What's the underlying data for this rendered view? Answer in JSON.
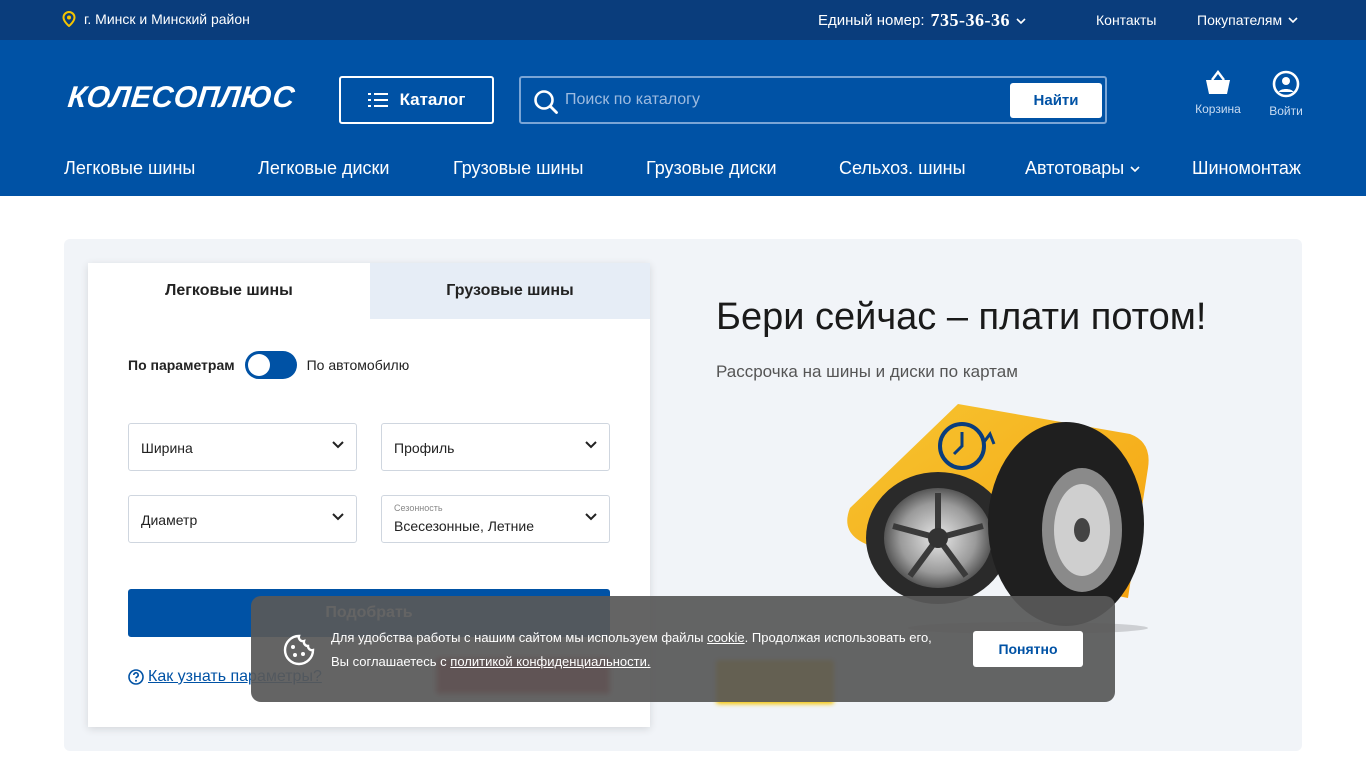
{
  "topbar": {
    "location": "г. Минск и Минский район",
    "phone_label": "Единый номер:",
    "phone_number": "735-36-36",
    "contacts": "Контакты",
    "buyers": "Покупателям"
  },
  "header": {
    "logo": "КОЛЕСОПЛЮС",
    "catalog_label": "Каталог",
    "search_placeholder": "Поиск по каталогу",
    "search_button": "Найти",
    "cart_label": "Корзина",
    "login_label": "Войти"
  },
  "nav": {
    "items": [
      {
        "label": "Легковые шины"
      },
      {
        "label": "Легковые диски"
      },
      {
        "label": "Грузовые шины"
      },
      {
        "label": "Грузовые диски"
      },
      {
        "label": "Сельхоз. шины"
      },
      {
        "label": "Автотовары"
      },
      {
        "label": "Шиномонтаж"
      }
    ]
  },
  "filter": {
    "tabs": [
      {
        "label": "Легковые шины",
        "active": true
      },
      {
        "label": "Грузовые шины",
        "active": false
      }
    ],
    "mode_left": "По параметрам",
    "mode_right": "По автомобилю",
    "width": "Ширина",
    "profile": "Профиль",
    "diameter": "Диаметр",
    "season_label": "Сезонность",
    "season_value": "Всесезонные, Летние",
    "pick_button": "Подобрать",
    "help_link": "Как узнать параметры?"
  },
  "promo": {
    "title": "Бери сейчас – плати потом!",
    "subtitle": "Рассрочка на шины и диски по картам"
  },
  "cookie": {
    "text_1": "Для удобства работы с нашим сайтом мы используем файлы ",
    "link_cookie": "cookie",
    "text_2": ". Продолжая использовать его, Вы соглашаетесь с ",
    "link_policy": "политикой конфиденциальности.",
    "button": "Понятно"
  },
  "colors": {
    "topbar": "#0a3d7c",
    "header": "#0052a5",
    "accent_yellow": "#f5b800",
    "promo_red": "#c8242a"
  }
}
